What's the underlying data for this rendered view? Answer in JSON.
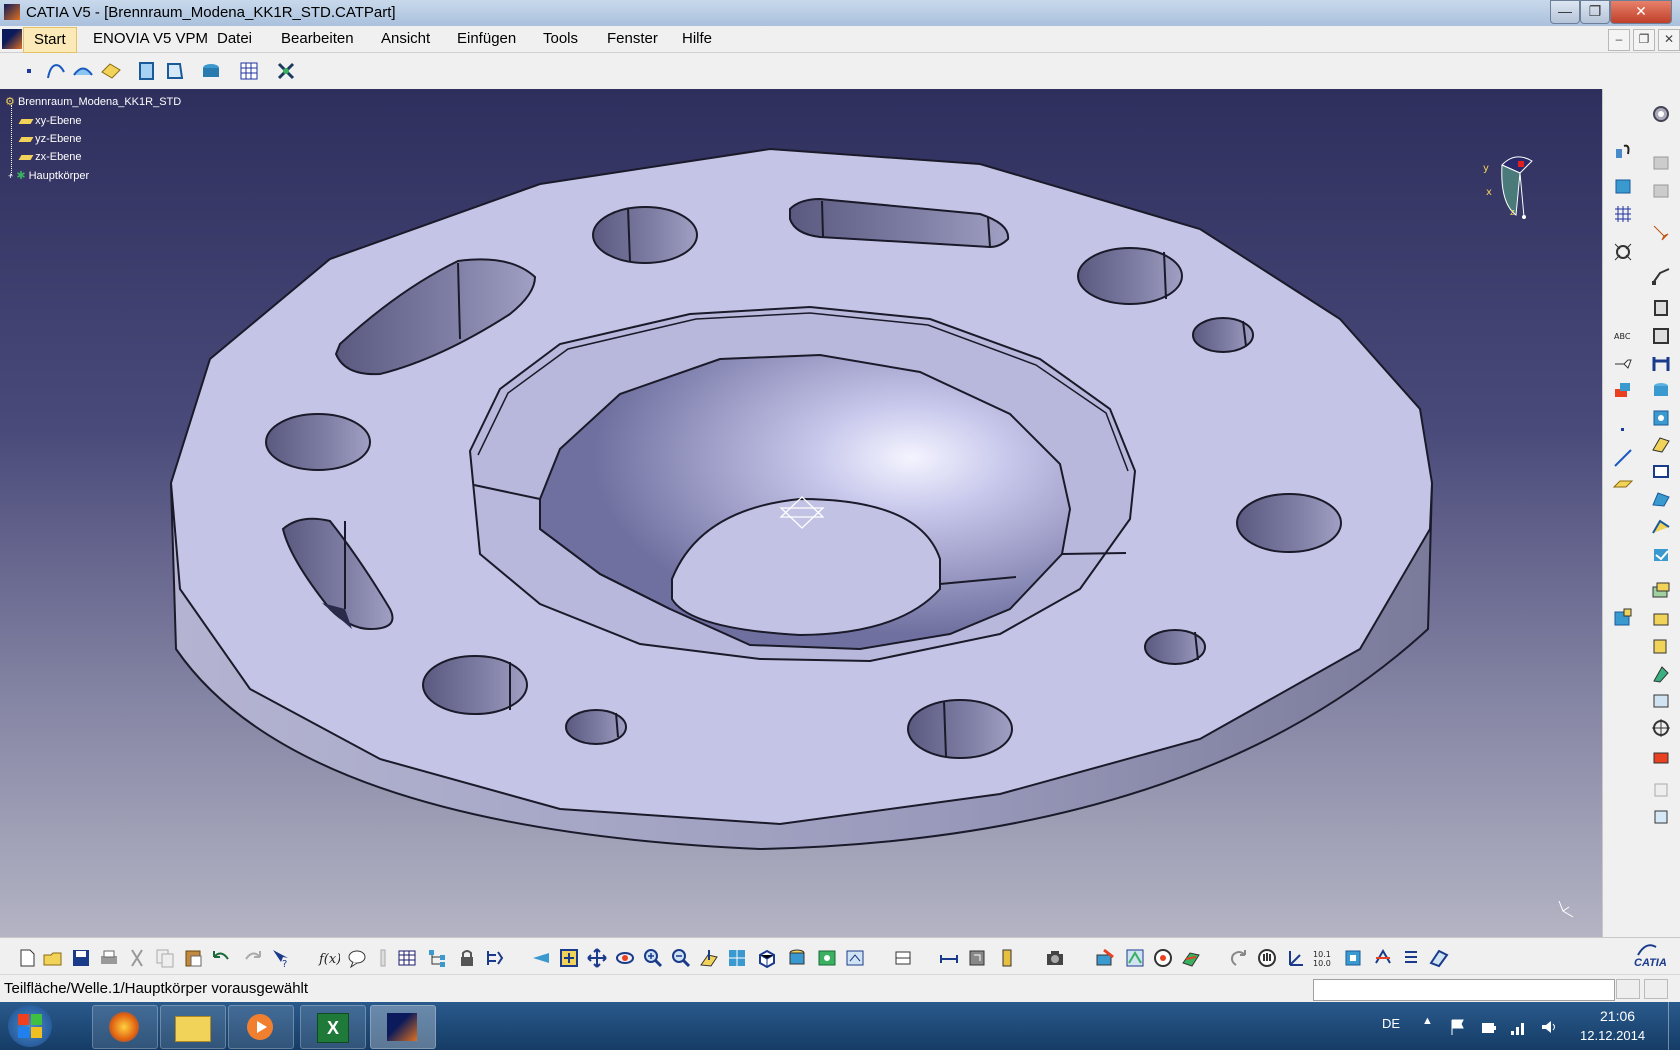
{
  "window": {
    "title": "CATIA V5 - [Brennraum_Modena_KK1R_STD.CATPart]",
    "controls": {
      "minimize": "—",
      "maximize": "❐",
      "close": "✕"
    }
  },
  "menu": {
    "items": [
      "Start",
      "ENOVIA V5 VPM",
      "Datei",
      "Bearbeiten",
      "Ansicht",
      "Einfügen",
      "Tools",
      "Fenster",
      "Hilfe"
    ],
    "mdi_controls": {
      "minimize": "–",
      "restore": "❐",
      "close": "✕"
    }
  },
  "tree": {
    "root": "Brennraum_Modena_KK1R_STD",
    "children": [
      "xy-Ebene",
      "yz-Ebene",
      "zx-Ebene",
      "Hauptkörper"
    ]
  },
  "compass": {
    "x_label": "x",
    "y_label": "y",
    "z_label": "z"
  },
  "status": {
    "message": "Teilfläche/Welle.1/Hauptkörper vorausgewählt",
    "command_input": ""
  },
  "brand": {
    "logo_text": "CATIA"
  },
  "taskbar": {
    "language": "DE",
    "time": "21:06",
    "date": "12.12.2014"
  },
  "colors": {
    "viewport_top": "#2f2f5e",
    "viewport_bottom": "#b4b4c4",
    "part_face": "#c4c4e6",
    "part_side": "#8d8dac",
    "hole_shade": "#6a6a8e",
    "edge": "#1a1a2a",
    "menu_highlight": "#fbe9b7",
    "taskbar": "#1f4c7c"
  },
  "icons": {
    "top_toolbar": [
      "point-icon",
      "spline-icon",
      "extrude-surface-icon",
      "plane-tool-icon",
      "part-body-icon",
      "body-icon",
      "hole-tool-icon",
      "grid-icon",
      "snap-icon"
    ],
    "right_toolbar": [
      "settings-icon",
      "sketch-icon",
      "pad-icon",
      "pocket-icon",
      "shaft-icon",
      "groove-icon",
      "hole-icon",
      "rib-icon",
      "slot-icon",
      "fillet-icon",
      "chamfer-icon",
      "draft-icon",
      "shell-icon",
      "thickness-icon",
      "thread-icon",
      "split-icon",
      "mirror-icon",
      "pattern-icon",
      "scale-icon",
      "boolean-icon"
    ],
    "bottom_toolbar": [
      "new-icon",
      "open-icon",
      "save-icon",
      "print-icon",
      "cut-icon",
      "copy-icon",
      "paste-icon",
      "undo-icon",
      "redo-icon",
      "whats-this-icon",
      "formula-icon",
      "comment-icon",
      "table-icon",
      "tree-icon",
      "lock-icon",
      "fly-mode-icon",
      "fit-all-icon",
      "pan-icon",
      "rotate-icon",
      "zoom-in-icon",
      "zoom-out-icon",
      "normal-view-icon",
      "multi-view-icon",
      "iso-view-icon",
      "shading-icon",
      "hide-show-icon",
      "swap-visible-icon",
      "measure-icon",
      "inertia-icon",
      "camera-icon",
      "apply-material-icon",
      "render-icon",
      "analysis-icon",
      "update-icon",
      "manipulate-icon",
      "axis-icon",
      "dimension-icon",
      "constraint-icon"
    ],
    "taskbar": [
      "windows-start-icon",
      "firefox-icon",
      "explorer-folder-icon",
      "media-player-icon",
      "excel-icon",
      "catia-icon"
    ]
  }
}
